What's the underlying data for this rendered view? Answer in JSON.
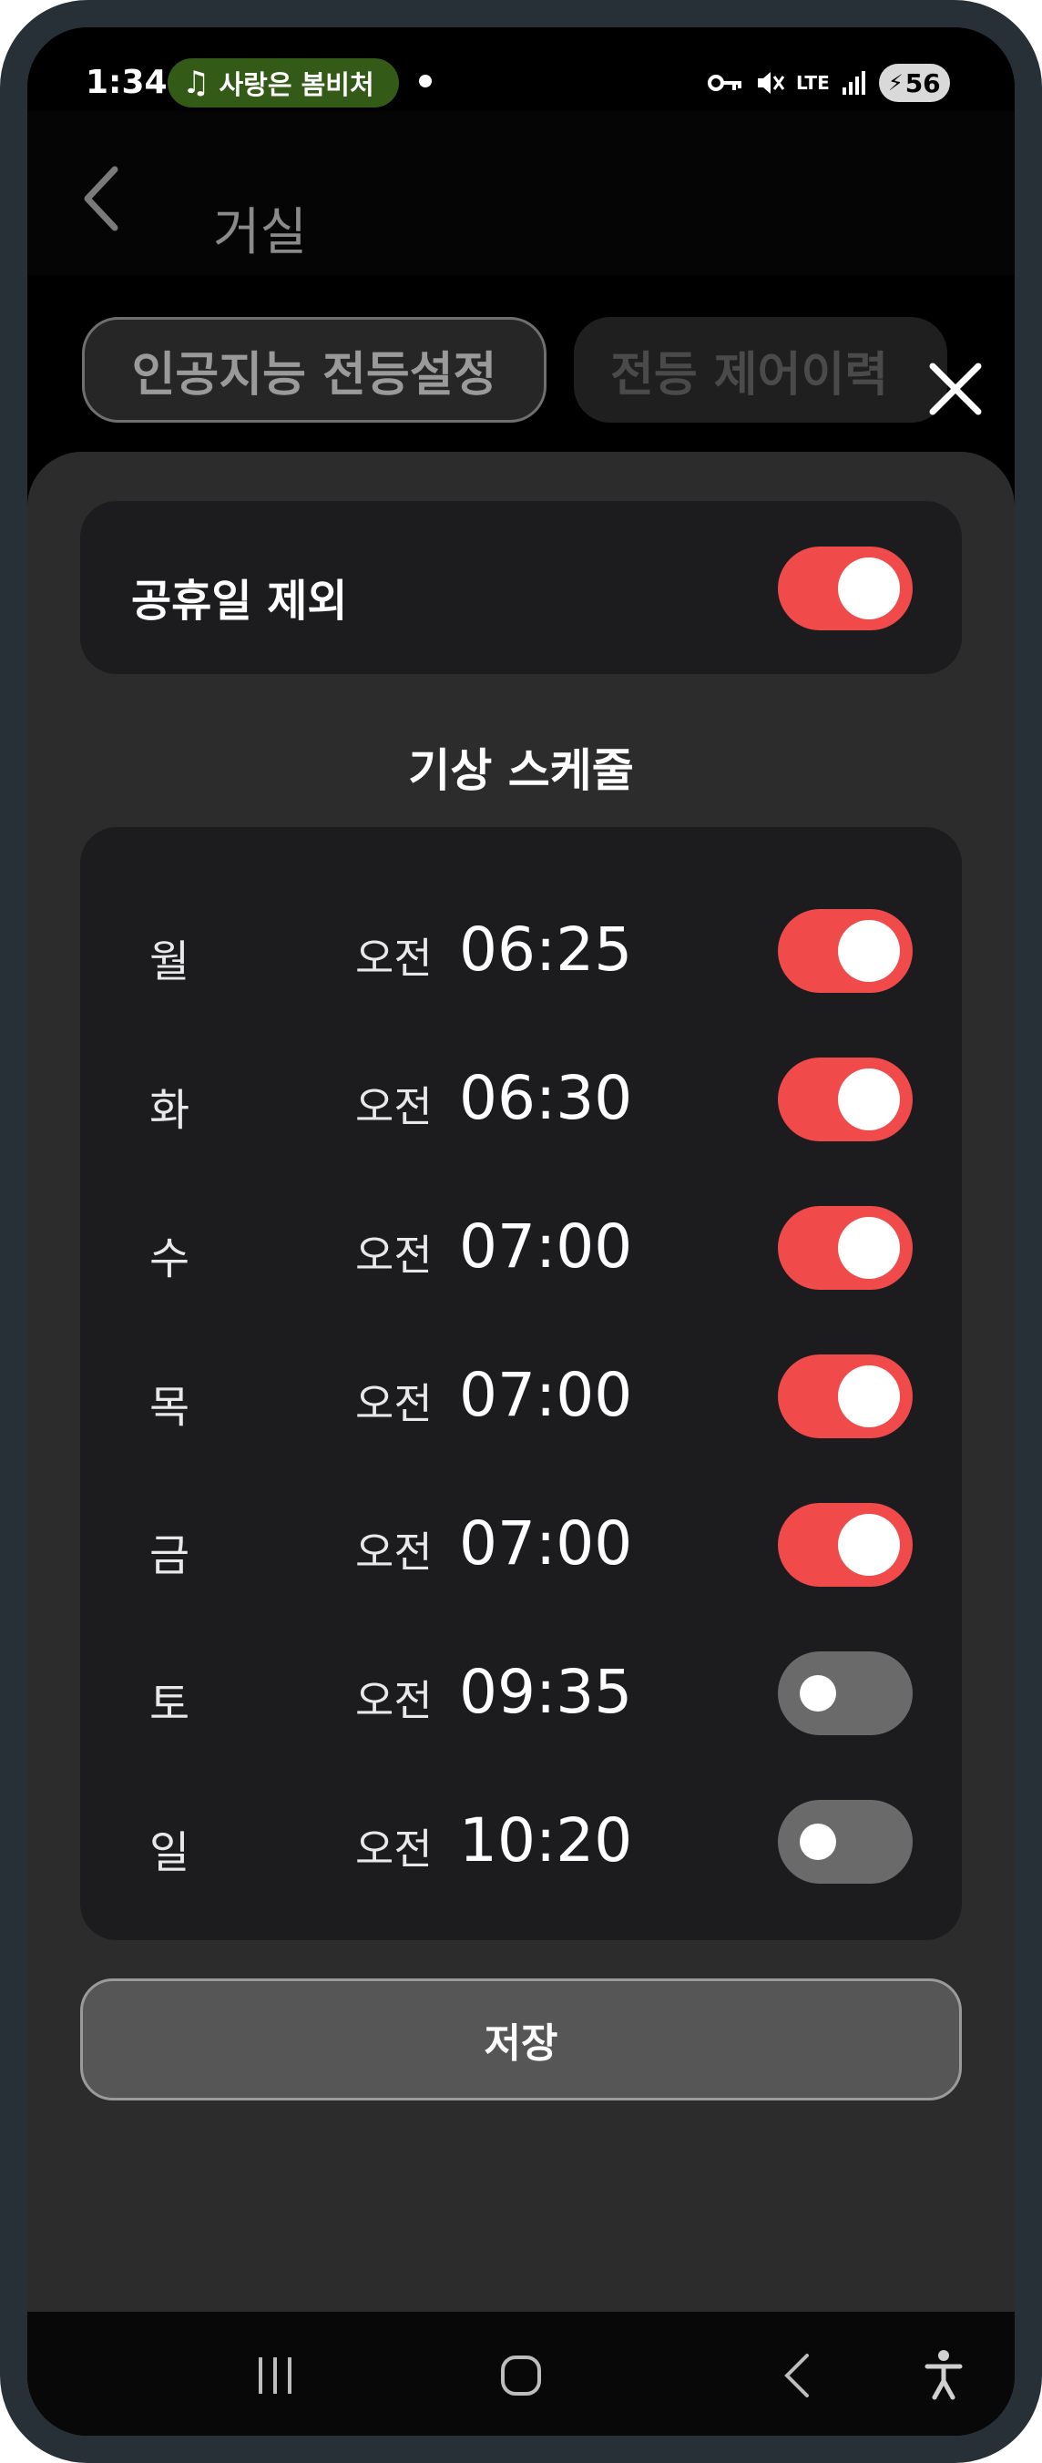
{
  "status_bar": {
    "time": "1:34",
    "music_text": "사랑은 봄비처",
    "network": "LTE",
    "battery": "56"
  },
  "app_bar": {
    "title": "거실"
  },
  "tabs": [
    {
      "label": "인공지능 전등설정"
    },
    {
      "label": "전등 제어이력"
    }
  ],
  "holiday": {
    "label": "공휴일 제외",
    "enabled": true
  },
  "schedule": {
    "title": "기상 스케줄",
    "rows": [
      {
        "day": "월",
        "ampm": "오전",
        "time": "06:25",
        "enabled": true
      },
      {
        "day": "화",
        "ampm": "오전",
        "time": "06:30",
        "enabled": true
      },
      {
        "day": "수",
        "ampm": "오전",
        "time": "07:00",
        "enabled": true
      },
      {
        "day": "목",
        "ampm": "오전",
        "time": "07:00",
        "enabled": true
      },
      {
        "day": "금",
        "ampm": "오전",
        "time": "07:00",
        "enabled": true
      },
      {
        "day": "토",
        "ampm": "오전",
        "time": "09:35",
        "enabled": false
      },
      {
        "day": "일",
        "ampm": "오전",
        "time": "10:20",
        "enabled": false
      }
    ]
  },
  "save_label": "저장",
  "colors": {
    "accent": "#f04a4a",
    "toggle_off": "#6a6a6a",
    "card": "#1c1c1e",
    "sheet": "#2c2c2c"
  },
  "icons": {
    "back": "chevron-left-icon",
    "close": "close-icon",
    "nav_recents": "recents-icon",
    "nav_home": "home-icon",
    "nav_back": "back-icon",
    "nav_accessibility": "accessibility-icon"
  }
}
